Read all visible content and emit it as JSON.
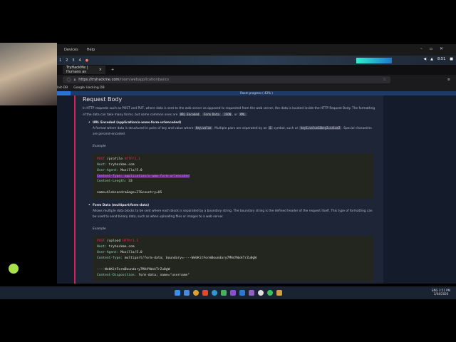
{
  "menubar": {
    "items": [
      "Devices",
      "Help"
    ]
  },
  "workspaces": [
    "1",
    "2",
    "3",
    "4"
  ],
  "tray": {
    "time": "8:51"
  },
  "browser": {
    "tab_title": "TryHackMe | Humans as",
    "url_host": "https://tryhackme.com",
    "url_path": "/room/webapplicationbasics",
    "bookmarks": [
      "loit-DB",
      "Google Hacking DB"
    ],
    "progress_label": "Room progress ( 42% )",
    "progress_percent": 42
  },
  "content": {
    "title": "Request Body",
    "intro": "In HTTP requests such as POST and PUT, where data is sent to the web server as opposed to requested from the web server, the data is located inside the HTTP Request Body. The formatting of the data can take many forms, but some common ones are",
    "formats": [
      "URL Encoded",
      "Form Data",
      "JSON",
      "XML"
    ],
    "urlenc_title": "URL Encoded (application/x-www-form-urlencoded)",
    "urlenc_desc1": "A format where data is structured in pairs of key and value where",
    "urlenc_code1": "key=value",
    "urlenc_desc2": ". Multiple pairs are separated by an",
    "urlenc_code2": "&",
    "urlenc_desc3": "symbol, such as",
    "urlenc_code3": "key1=value1&key2=value2",
    "urlenc_desc4": ". Special characters are percent-encoded.",
    "example_label": "Example",
    "code1": {
      "method": "POST",
      "path": " /profile ",
      "proto": "HTTP/1.1",
      "host_k": "Host:",
      "host_v": " tryhackme.com",
      "ua_k": "User-Agent:",
      "ua_v": " Mozilla/5.0",
      "ct": "Content-Type: application/x-www-form-urlencoded",
      "cl_k": "Content-Length:",
      "cl_v": " 33",
      "body": "name=Aleksandra&age=27&country=US"
    },
    "form_title": "Form Data (multipart/form-data)",
    "form_desc": "Allows multiple data blocks to be sent where each block is separated by a boundary string. The boundary string is the defined header of the request itself. This type of formatting can be used to send binary data, such as when uploading files or images to a web server.",
    "code2": {
      "method": "POST",
      "path": " /upload ",
      "proto": "HTTP/1.1",
      "host_k": "Host:",
      "host_v": " tryhackme.com",
      "ua_k": "User-Agent:",
      "ua_v": " Mozilla/5.0",
      "ct_k": "Content-Type:",
      "ct_v": " multipart/form-data; boundary=----WebKitFormBoundary7MA4YWxkTrZu0gW",
      "boundary": "----WebKitFormBoundary7MA4YWxkTrZu0gW",
      "cd_k": "Content-Disposition:",
      "cd_v": " form-data; name=\"username\""
    }
  },
  "clock": {
    "time": "3:51 PM",
    "date": "1/04/2026",
    "lang": "ENG"
  }
}
